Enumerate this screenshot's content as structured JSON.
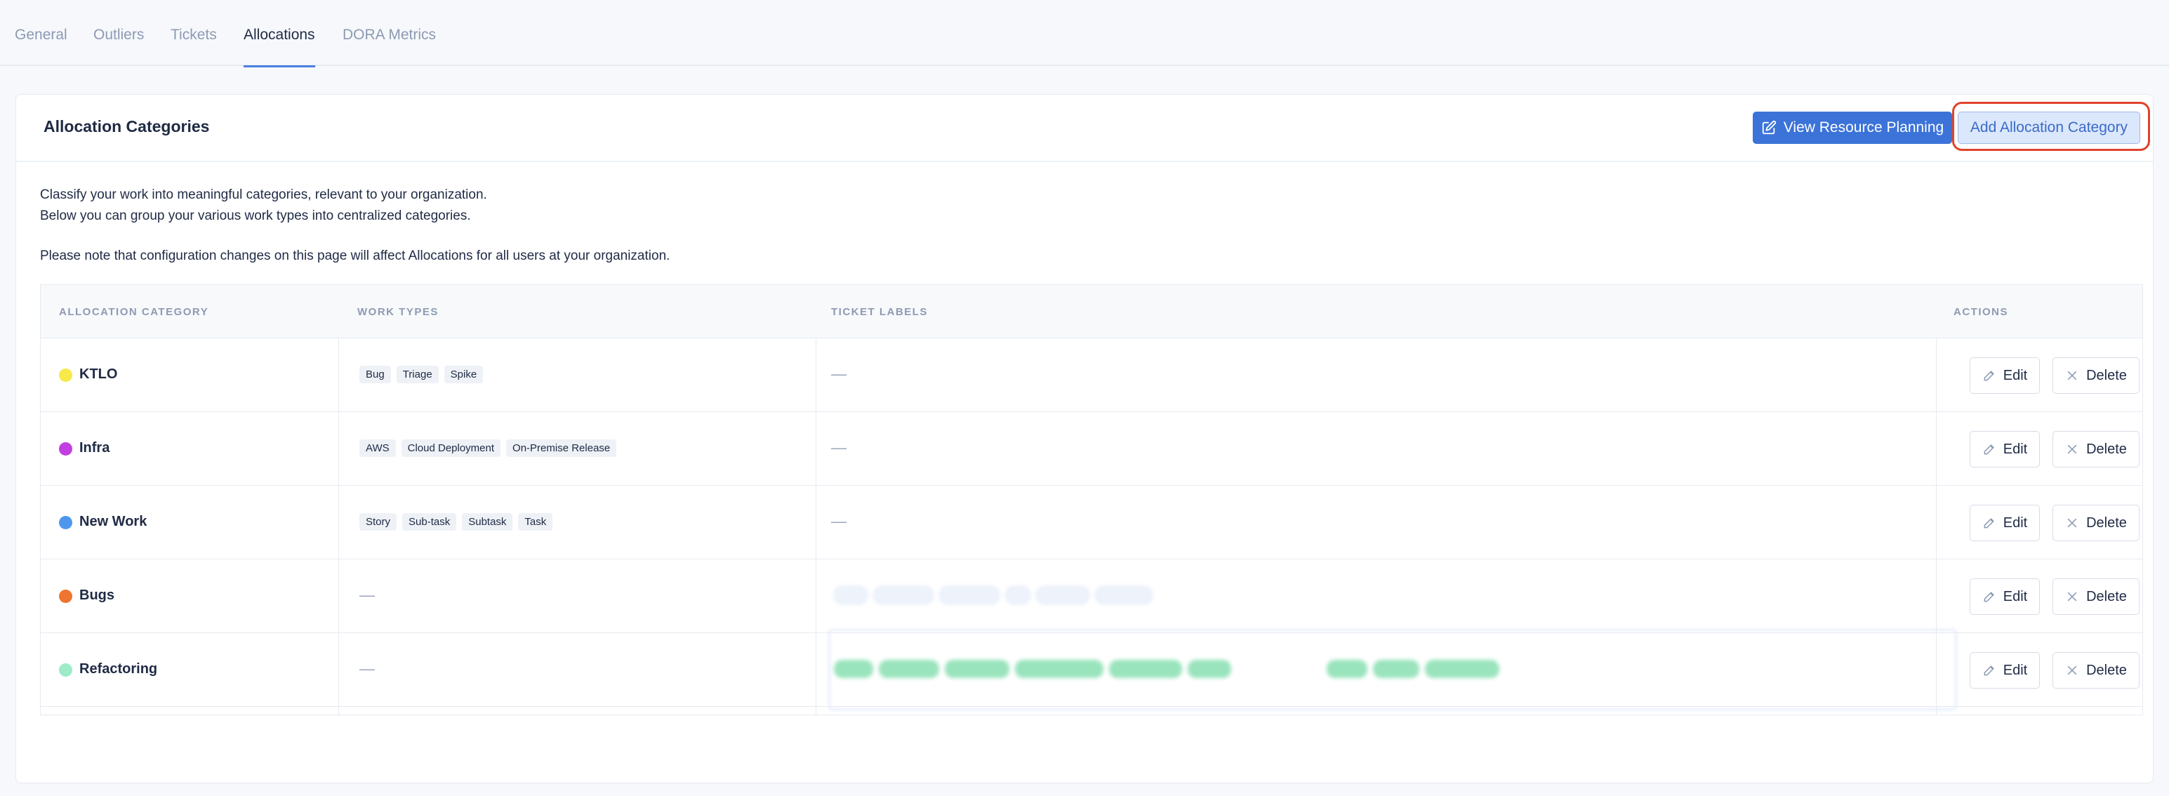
{
  "tabs": [
    {
      "label": "General"
    },
    {
      "label": "Outliers"
    },
    {
      "label": "Tickets"
    },
    {
      "label": "Allocations",
      "active": true
    },
    {
      "label": "DORA Metrics"
    }
  ],
  "card": {
    "title": "Allocation Categories",
    "view_button": "View Resource Planning",
    "add_button": "Add Allocation Category",
    "description": [
      "Classify your work into meaningful categories, relevant to your organization.",
      "Below you can group your various work types into centralized categories.",
      "Please note that configuration changes on this page will affect Allocations for all users at your organization."
    ]
  },
  "table": {
    "headers": {
      "category": "ALLOCATION CATEGORY",
      "work_types": "WORK TYPES",
      "ticket_labels": "TICKET LABELS",
      "actions": "ACTIONS"
    },
    "edit_label": "Edit",
    "delete_label": "Delete",
    "empty_value": "—",
    "rows": [
      {
        "name": "KTLO",
        "color": "#f7e94a",
        "work_types": [
          "Bug",
          "Triage",
          "Spike"
        ],
        "ticket_labels": "—"
      },
      {
        "name": "Infra",
        "color": "#c13fe0",
        "work_types": [
          "AWS",
          "Cloud Deployment",
          "On-Premise Release"
        ],
        "ticket_labels": "—"
      },
      {
        "name": "New Work",
        "color": "#4f97ee",
        "work_types": [
          "Story",
          "Sub-task",
          "Subtask",
          "Task"
        ],
        "ticket_labels": "—"
      },
      {
        "name": "Bugs",
        "color": "#ee7530",
        "work_types": "—",
        "ticket_labels": "redacted"
      },
      {
        "name": "Refactoring",
        "color": "#9debc8",
        "work_types": "—",
        "ticket_labels": "redacted"
      }
    ]
  },
  "colors": {
    "accent": "#3b73d9",
    "highlight": "#e0432b"
  }
}
